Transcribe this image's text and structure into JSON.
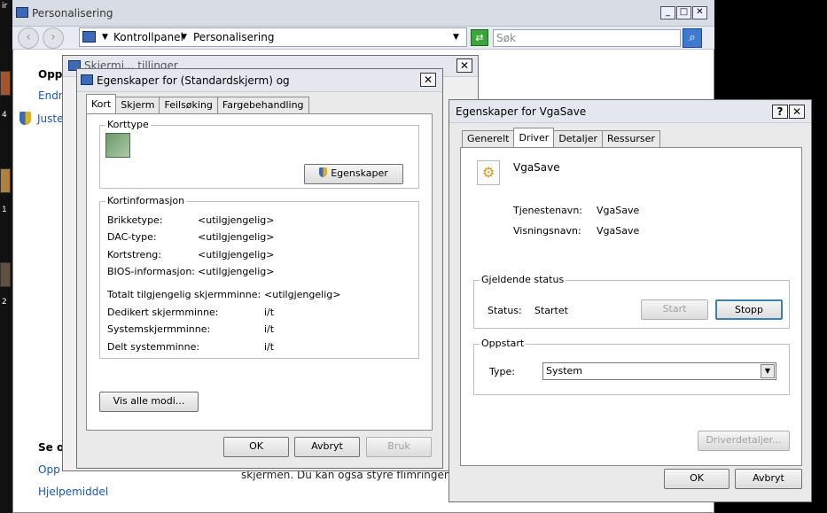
{
  "desktop": {
    "labels": [
      "ir",
      "4",
      "1",
      "2"
    ]
  },
  "personalisation": {
    "title": "Personalisering",
    "breadcrumb": [
      "Kontrollpanel",
      "Personalisering"
    ],
    "search_placeholder": "Søk",
    "sidebar_partial": [
      "Opp",
      "Endr",
      "Juste"
    ],
    "see_also_partial": "Se o",
    "bottom_links": [
      "Opp",
      "Hjelpemiddel"
    ],
    "bottom_text": "skjermen. Du kan også styre flimringen på s"
  },
  "screen_settings": {
    "title_partial": "Skjermi... tillinger"
  },
  "adapter_props": {
    "title": "Egenskaper for (Standardskjerm) og",
    "tabs": [
      "Kort",
      "Skjerm",
      "Feilsøking",
      "Fargebehandling"
    ],
    "adapter_type_label": "Korttype",
    "properties_button": "Egenskaper",
    "info_label": "Kortinformasjon",
    "info_rows": [
      {
        "label": "Brikketype:",
        "value": "<utilgjengelig>"
      },
      {
        "label": "DAC-type:",
        "value": "<utilgjengelig>"
      },
      {
        "label": "Kortstreng:",
        "value": "<utilgjengelig>"
      },
      {
        "label": "BIOS-informasjon:",
        "value": "<utilgjengelig>"
      }
    ],
    "memory_rows": [
      {
        "label": "Totalt tilgjengelig skjermminne:",
        "value": "<utilgjengelig>"
      },
      {
        "label": "Dedikert skjermminne:",
        "value": "i/t"
      },
      {
        "label": "Systemskjermminne:",
        "value": "i/t"
      },
      {
        "label": "Delt systemminne:",
        "value": "i/t"
      }
    ],
    "list_modes_button": "Vis alle modi...",
    "ok": "OK",
    "cancel": "Avbryt",
    "apply": "Bruk"
  },
  "vgasave": {
    "title": "Egenskaper for VgaSave",
    "help": "?",
    "tabs": [
      "Generelt",
      "Driver",
      "Detaljer",
      "Ressurser"
    ],
    "device_name": "VgaSave",
    "service_name_label": "Tjenestenavn:",
    "service_name": "VgaSave",
    "display_name_label": "Visningsnavn:",
    "display_name": "VgaSave",
    "status_group": "Gjeldende status",
    "status_label": "Status:",
    "status_value": "Startet",
    "start": "Start",
    "stop": "Stopp",
    "startup_group": "Oppstart",
    "type_label": "Type:",
    "type_value": "System",
    "driver_details": "Driverdetaljer...",
    "ok": "OK",
    "cancel": "Avbryt"
  }
}
